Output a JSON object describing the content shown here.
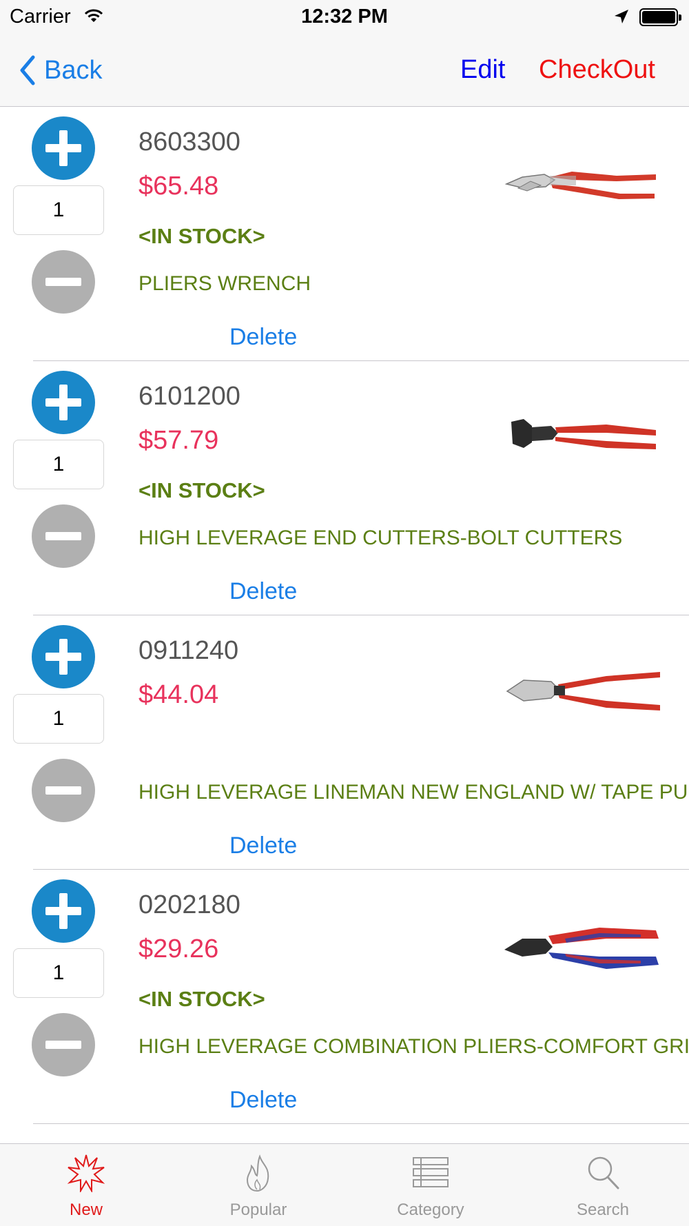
{
  "colors": {
    "accent_blue": "#1a7ee6",
    "edit_blue": "#0000ee",
    "checkout_red": "#ee1111",
    "price_red": "#e8325c",
    "stock_green": "#5b7f14",
    "plus_blue": "#1a88c9",
    "minus_gray": "#b0b0b0",
    "tab_active": "#e01b1b",
    "tab_inactive": "#999999"
  },
  "status_bar": {
    "carrier": "Carrier",
    "time": "12:32 PM",
    "icons": [
      "wifi-icon",
      "location-arrow-icon",
      "battery-icon"
    ]
  },
  "nav": {
    "back_label": "Back",
    "edit_label": "Edit",
    "checkout_label": "CheckOut"
  },
  "cart": {
    "items": [
      {
        "code": "8603300",
        "price": "$65.48",
        "stock": "<IN STOCK>",
        "description": "PLIERS WRENCH",
        "quantity": "1",
        "delete_label": "Delete",
        "image_icon": "pliers-wrench-image"
      },
      {
        "code": "6101200",
        "price": "$57.79",
        "stock": "<IN STOCK>",
        "description": "HIGH LEVERAGE END CUTTERS-BOLT CUTTERS",
        "quantity": "1",
        "delete_label": "Delete",
        "image_icon": "end-cutters-image"
      },
      {
        "code": "0911240",
        "price": "$44.04",
        "stock": "",
        "description": "HIGH LEVERAGE LINEMAN NEW ENGLAND W/ TAPE PULLER",
        "quantity": "1",
        "delete_label": "Delete",
        "image_icon": "lineman-pliers-image"
      },
      {
        "code": "0202180",
        "price": "$29.26",
        "stock": "<IN STOCK>",
        "description": "HIGH LEVERAGE COMBINATION PLIERS-COMFORT GRIP",
        "quantity": "1",
        "delete_label": "Delete",
        "image_icon": "combination-pliers-image"
      }
    ]
  },
  "tabs": [
    {
      "label": "New",
      "icon": "starburst-icon",
      "active": true
    },
    {
      "label": "Popular",
      "icon": "flame-icon",
      "active": false
    },
    {
      "label": "Category",
      "icon": "list-icon",
      "active": false
    },
    {
      "label": "Search",
      "icon": "magnifier-icon",
      "active": false
    }
  ]
}
